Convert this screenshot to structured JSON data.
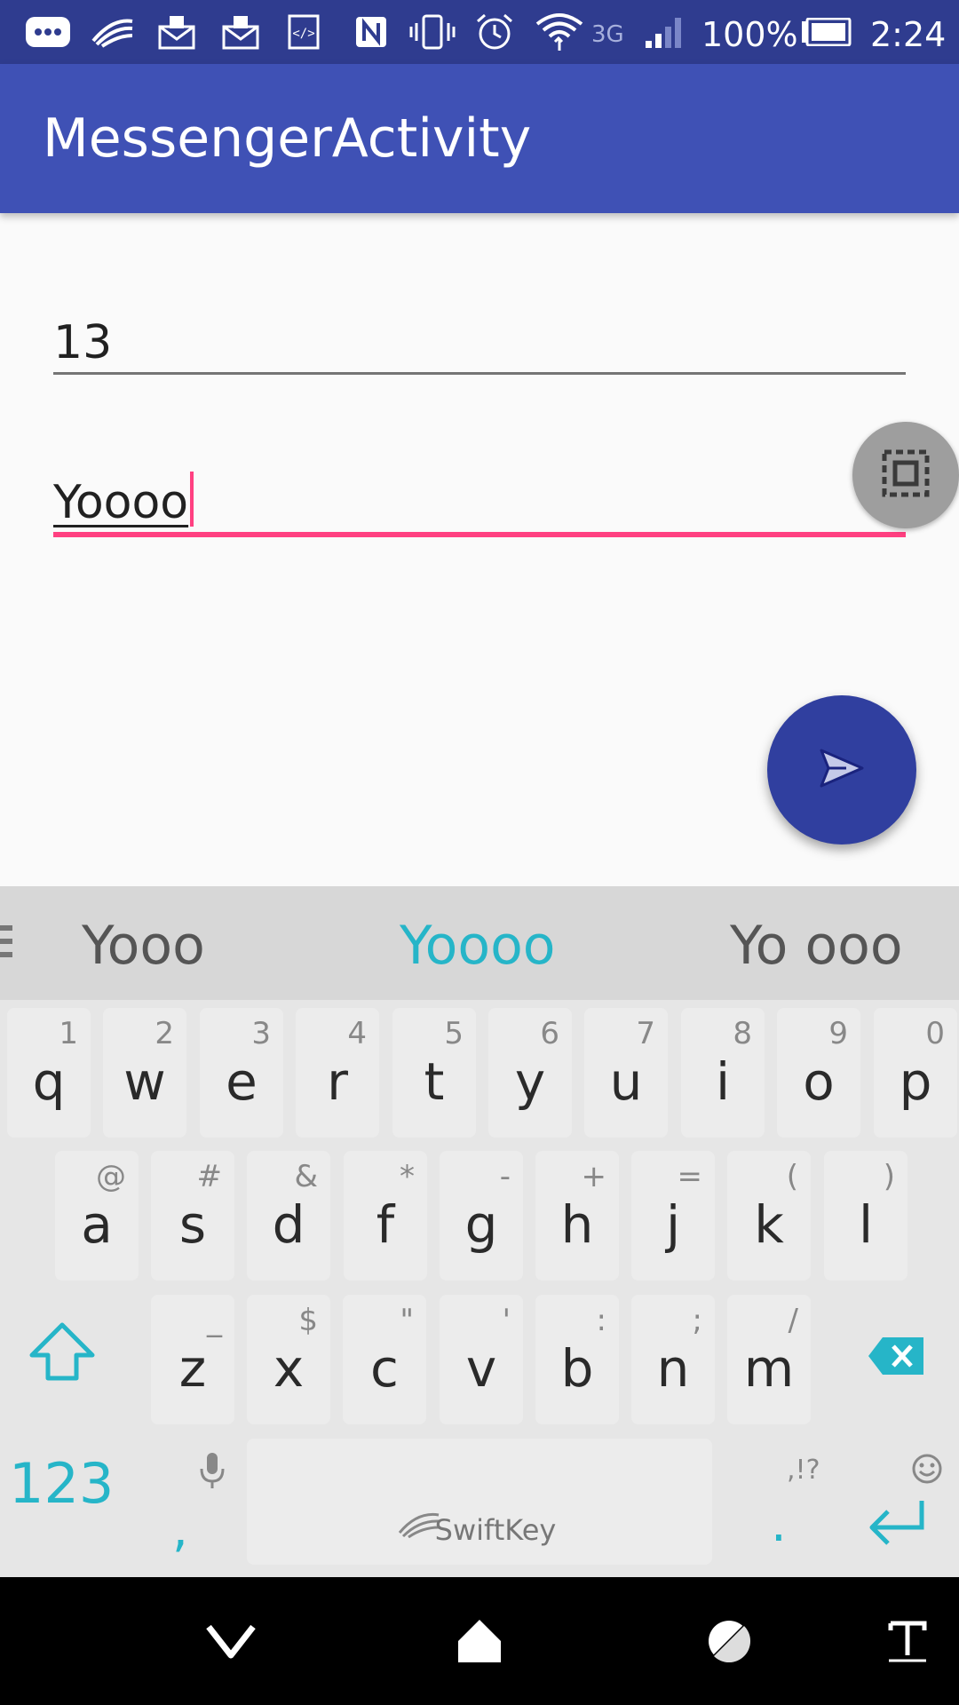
{
  "status_bar": {
    "icons": [
      "more-notifications-icon",
      "swiftkey-icon",
      "gmail-icon",
      "gmail-icon",
      "dev-code-icon",
      "nfc-icon",
      "vibrate-icon",
      "alarm-icon",
      "wifi-icon",
      "3g-icon",
      "signal-icon",
      "battery-icon"
    ],
    "network": "3G",
    "battery": "100%",
    "time": "2:24"
  },
  "app_bar": {
    "title": "MessengerActivity"
  },
  "form": {
    "field1_value": "13",
    "field2_value": "Yoooo",
    "send_icon": "send-icon",
    "overlay_icon": "screenshot-select-icon"
  },
  "keyboard": {
    "suggestions": [
      "Yooo",
      "Yoooo",
      "Yo ooo"
    ],
    "row1": [
      {
        "letter": "q",
        "hint": "1"
      },
      {
        "letter": "w",
        "hint": "2"
      },
      {
        "letter": "e",
        "hint": "3"
      },
      {
        "letter": "r",
        "hint": "4"
      },
      {
        "letter": "t",
        "hint": "5"
      },
      {
        "letter": "y",
        "hint": "6"
      },
      {
        "letter": "u",
        "hint": "7"
      },
      {
        "letter": "i",
        "hint": "8"
      },
      {
        "letter": "o",
        "hint": "9"
      },
      {
        "letter": "p",
        "hint": "0"
      }
    ],
    "row2": [
      {
        "letter": "a",
        "hint": "@"
      },
      {
        "letter": "s",
        "hint": "#"
      },
      {
        "letter": "d",
        "hint": "&"
      },
      {
        "letter": "f",
        "hint": "*"
      },
      {
        "letter": "g",
        "hint": "-"
      },
      {
        "letter": "h",
        "hint": "+"
      },
      {
        "letter": "j",
        "hint": "="
      },
      {
        "letter": "k",
        "hint": "("
      },
      {
        "letter": "l",
        "hint": ")"
      }
    ],
    "row3": [
      {
        "letter": "z",
        "hint": "_"
      },
      {
        "letter": "x",
        "hint": "$"
      },
      {
        "letter": "c",
        "hint": "\""
      },
      {
        "letter": "v",
        "hint": "'"
      },
      {
        "letter": "b",
        "hint": ":"
      },
      {
        "letter": "n",
        "hint": ";"
      },
      {
        "letter": "m",
        "hint": "/"
      }
    ],
    "numbers_key": "123",
    "comma_key": ",",
    "period_key": ".",
    "punct_hint": ",!?",
    "space_label": "SwiftKey",
    "accent_color": "#26b5c8"
  },
  "nav_bar": {
    "icons": [
      "back-icon",
      "home-icon",
      "recents-icon",
      "keyboard-switch-icon"
    ]
  }
}
